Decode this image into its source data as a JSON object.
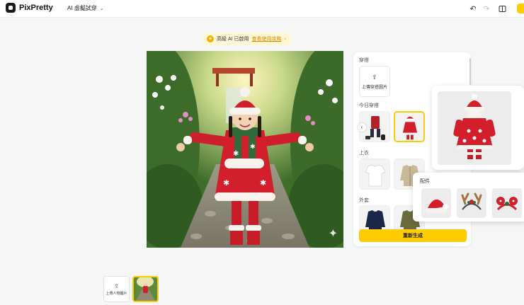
{
  "header": {
    "logo_text": "PixPretty",
    "mode_label": "AI 虛擬試穿",
    "tools": [
      "undo-icon",
      "redo-icon",
      "compare-icon"
    ]
  },
  "banner": {
    "text": "高級 AI 已啟用",
    "link": "查看使用攻略"
  },
  "panel": {
    "upload_section": "穿搭",
    "upload_label": "上傳穿搭圖片",
    "today_section": "今日穿搭",
    "tops_section": "上衣",
    "outer_section": "外套",
    "generate_button": "重新生成"
  },
  "accessories": {
    "label": "配件",
    "items": [
      "santa-hat",
      "reindeer-antler-headband",
      "christmas-headband"
    ]
  },
  "bottom": {
    "upload_label": "上傳人物圖片"
  },
  "colors": {
    "accent": "#ffcc00",
    "outfit_red": "#d21f2b",
    "banner_bg": "#fff7d6"
  }
}
